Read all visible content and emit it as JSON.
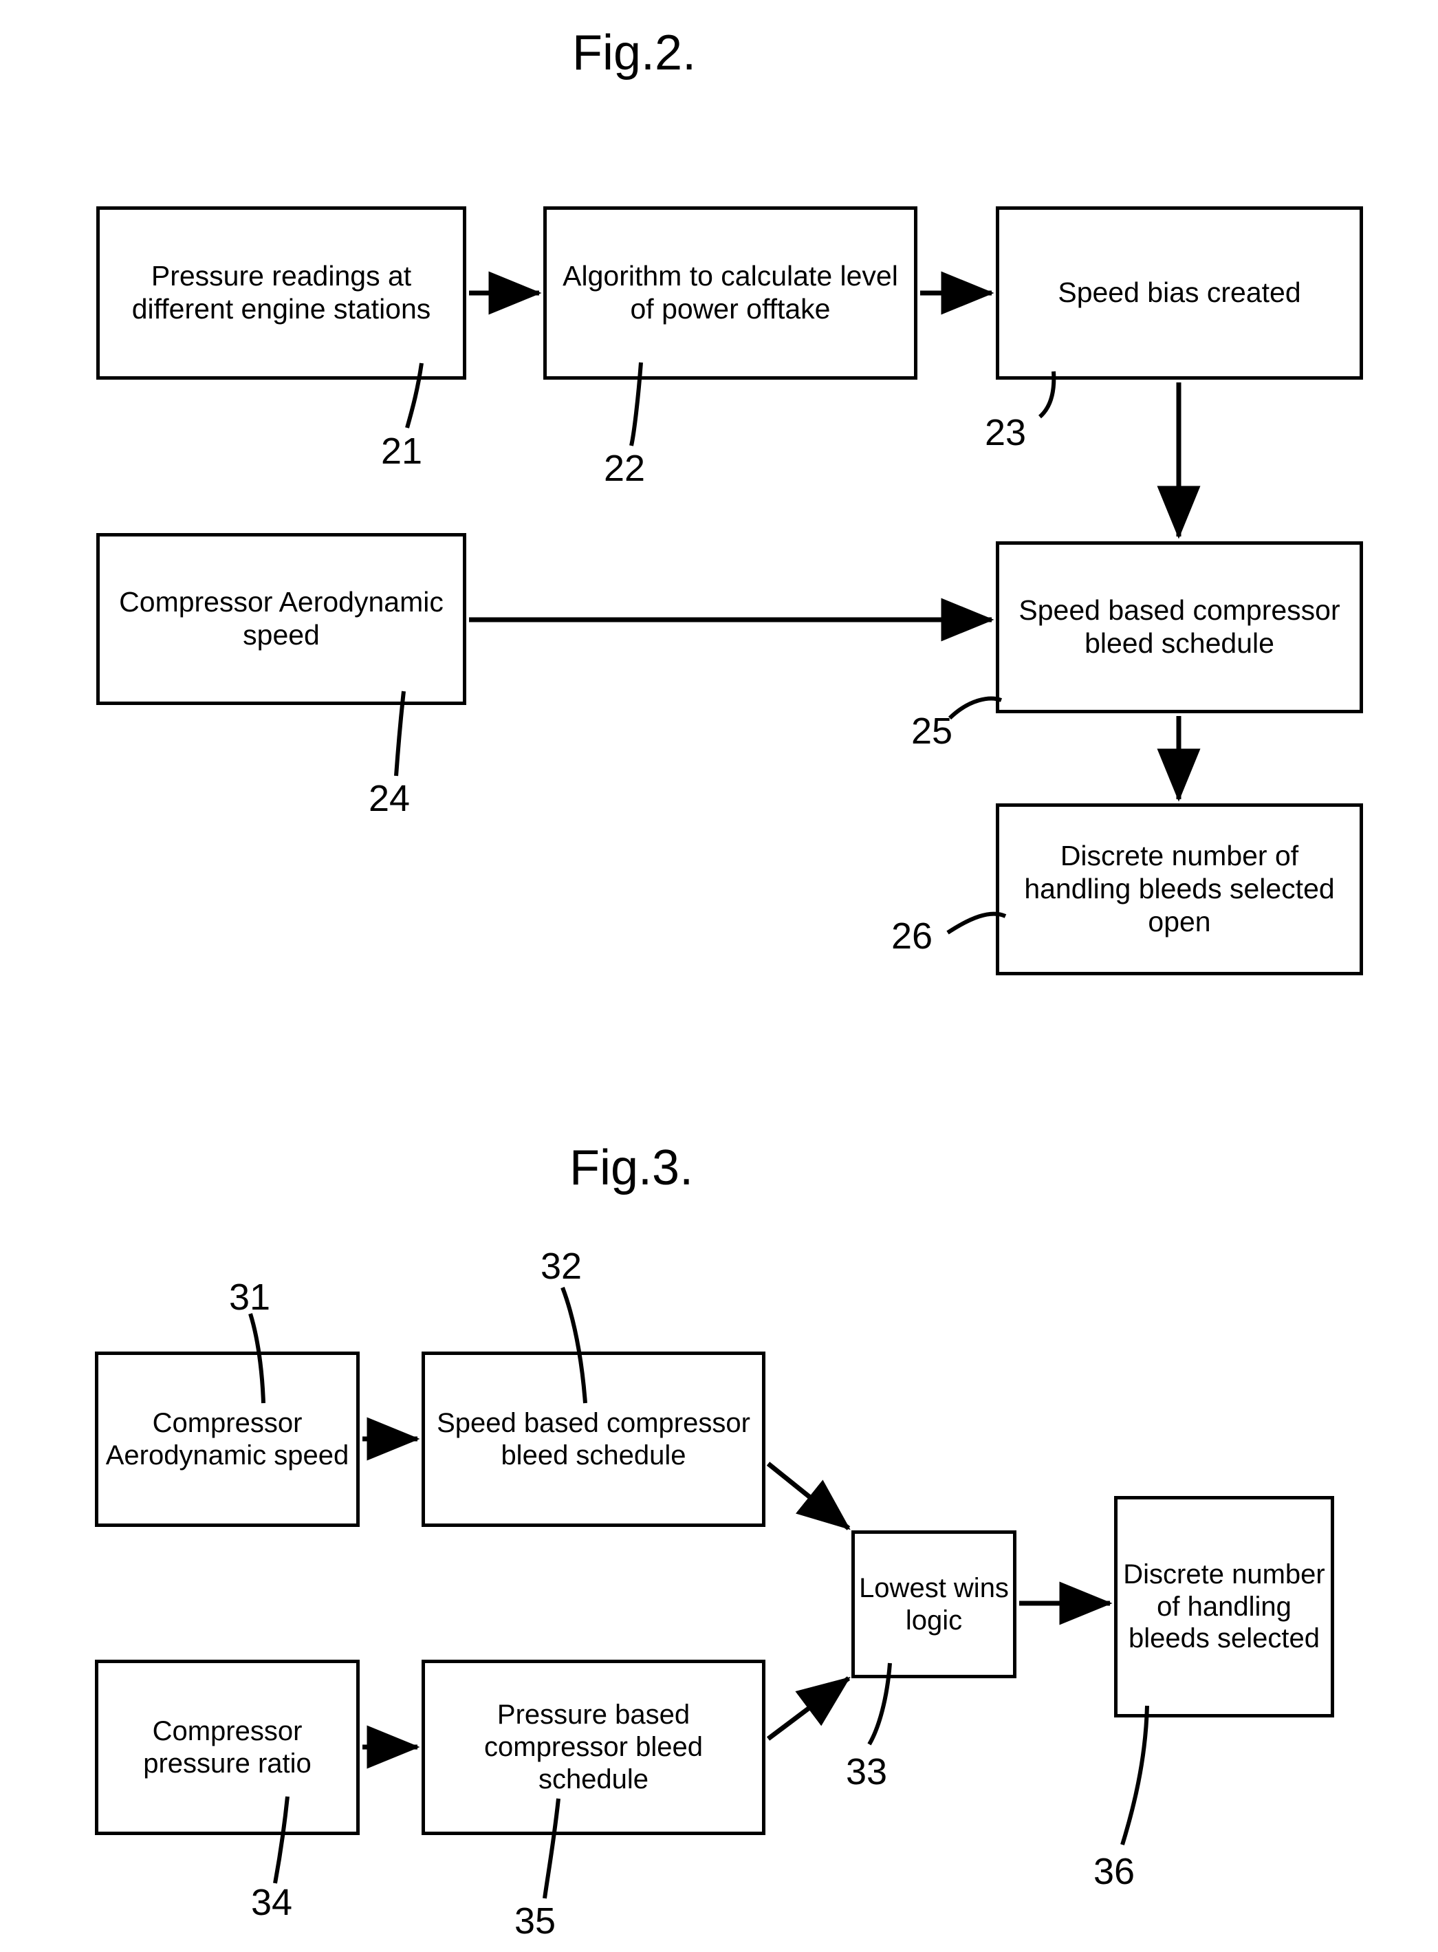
{
  "document": {
    "type": "patent-drawing-sheet",
    "figures": [
      {
        "id": "fig2",
        "title": "Fig.2.",
        "nodes": [
          {
            "ref": "21",
            "label": "Pressure readings at different engine stations"
          },
          {
            "ref": "22",
            "label": "Algorithm to calculate level of power offtake"
          },
          {
            "ref": "23",
            "label": "Speed bias created"
          },
          {
            "ref": "24",
            "label": "Compressor Aerodynamic speed"
          },
          {
            "ref": "25",
            "label": "Speed based compressor bleed schedule"
          },
          {
            "ref": "26",
            "label": "Discrete number of handling bleeds selected open"
          }
        ],
        "ref_labels": [
          "21",
          "22",
          "23",
          "24",
          "25",
          "26"
        ]
      },
      {
        "id": "fig3",
        "title": "Fig.3.",
        "nodes": [
          {
            "ref": "31",
            "label": "Compressor Aerodynamic speed"
          },
          {
            "ref": "32",
            "label": "Speed based compressor bleed schedule"
          },
          {
            "ref": "33",
            "label": "Lowest wins logic"
          },
          {
            "ref": "34",
            "label": "Compressor pressure ratio"
          },
          {
            "ref": "35",
            "label": "Pressure based compressor bleed schedule"
          },
          {
            "ref": "36",
            "label": "Discrete number of handling bleeds selected"
          }
        ],
        "ref_labels": [
          "31",
          "32",
          "33",
          "34",
          "35",
          "36"
        ]
      }
    ],
    "colors": {
      "ink": "#000000",
      "paper": "#ffffff"
    }
  },
  "fig2": {
    "title": "Fig.2.",
    "box21": "Pressure readings at different engine stations",
    "box22": "Algorithm to calculate level of power offtake",
    "box23": "Speed bias created",
    "box24": "Compressor Aerodynamic speed",
    "box25": "Speed based compressor bleed schedule",
    "box26": "Discrete number of handling bleeds selected open",
    "ref21": "21",
    "ref22": "22",
    "ref23": "23",
    "ref24": "24",
    "ref25": "25",
    "ref26": "26"
  },
  "fig3": {
    "title": "Fig.3.",
    "box31": "Compressor Aerodynamic speed",
    "box32": "Speed based compressor bleed schedule",
    "box33": "Lowest wins logic",
    "box34": "Compressor pressure ratio",
    "box35": "Pressure based compressor bleed schedule",
    "box36": "Discrete number of handling bleeds selected",
    "ref31": "31",
    "ref32": "32",
    "ref33": "33",
    "ref34": "34",
    "ref35": "35",
    "ref36": "36"
  }
}
